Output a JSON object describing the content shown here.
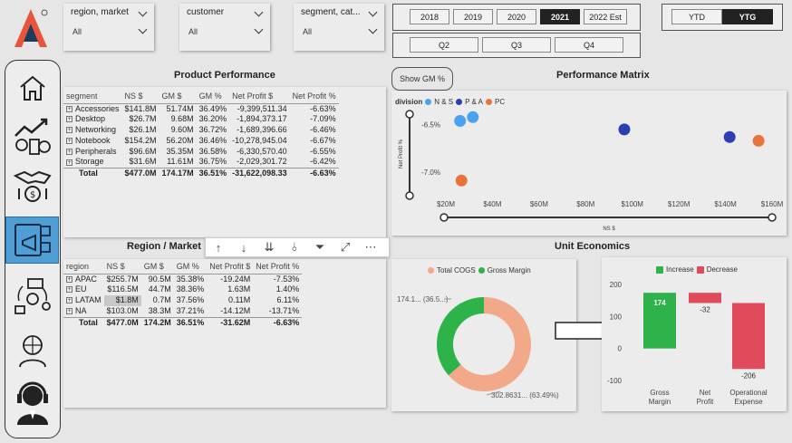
{
  "slicers": {
    "region": {
      "label": "region, market",
      "value": "All"
    },
    "customer": {
      "label": "customer",
      "value": "All"
    },
    "segment": {
      "label": "segment, cat...",
      "value": "All"
    }
  },
  "years": [
    "2018",
    "2019",
    "2020",
    "2021",
    "2022 Est"
  ],
  "selected_year": "2021",
  "quarters": [
    "Q2",
    "Q3",
    "Q4"
  ],
  "period_toggle": {
    "ytd": "YTD",
    "ytg": "YTG"
  },
  "product_performance": {
    "title": "Product Performance",
    "columns": [
      "segment",
      "NS $",
      "GM $",
      "GM %",
      "Net Profit $",
      "Net Profit %"
    ],
    "rows": [
      [
        "Accessories",
        "$141.8M",
        "51.74M",
        "36.49%",
        "-9,399,511.34",
        "-6.63%"
      ],
      [
        "Desktop",
        "$26.7M",
        "9.68M",
        "36.20%",
        "-1,894,373.17",
        "-7.09%"
      ],
      [
        "Networking",
        "$26.1M",
        "9.60M",
        "36.72%",
        "-1,689,396.66",
        "-6.46%"
      ],
      [
        "Notebook",
        "$154.2M",
        "56.20M",
        "36.46%",
        "-10,278,945.04",
        "-6.67%"
      ],
      [
        "Peripherals",
        "$96.6M",
        "35.35M",
        "36.58%",
        "-6,330,570.40",
        "-6.55%"
      ],
      [
        "Storage",
        "$31.6M",
        "11.61M",
        "36.75%",
        "-2,029,301.72",
        "-6.42%"
      ]
    ],
    "total": [
      "Total",
      "$477.0M",
      "174.17M",
      "36.51%",
      "-31,622,098.33",
      "-6.63%"
    ]
  },
  "show_gm_button": "Show GM %",
  "performance_matrix": {
    "title": "Performance Matrix",
    "legend_title": "division",
    "legend": [
      {
        "name": "N & S",
        "color": "#4aa3f0"
      },
      {
        "name": "P & A",
        "color": "#2b3fb0"
      },
      {
        "name": "PC",
        "color": "#e8743b"
      }
    ]
  },
  "region_market": {
    "title": "Region / Market",
    "title_tail": "n",
    "columns": [
      "region",
      "NS $",
      "GM $",
      "GM %",
      "Net Profit $",
      "Net Profit %"
    ],
    "rows": [
      [
        "APAC",
        "$255.7M",
        "90.5M",
        "35.38%",
        "-19.24M",
        "-7.53%"
      ],
      [
        "EU",
        "$116.5M",
        "44.7M",
        "38.36%",
        "1.63M",
        "1.40%"
      ],
      [
        "LATAM",
        "$1.8M",
        "0.7M",
        "37.56%",
        "0.11M",
        "6.11%"
      ],
      [
        "NA",
        "$103.0M",
        "38.3M",
        "37.21%",
        "-14.12M",
        "-13.71%"
      ]
    ],
    "total": [
      "Total",
      "$477.0M",
      "174.2M",
      "36.51%",
      "-31.62M",
      "-6.63%"
    ]
  },
  "toolbar_icons": [
    "arrow-up-icon",
    "arrow-down-icon",
    "double-arrow-down-icon",
    "expand-hierarchy-icon",
    "filter-icon",
    "focus-mode-icon",
    "more-options-icon"
  ],
  "unit_economics": {
    "title": "Unit Economics",
    "donut_legend": [
      {
        "name": "Total COGS",
        "color": "#f2a98a"
      },
      {
        "name": "Gross Margin",
        "color": "#2db34a"
      }
    ],
    "donut_label_top": "174.1... (36.5...)",
    "donut_label_bottom": "302.8631... (63.49%)",
    "waterfall_legend": [
      {
        "name": "Increase",
        "color": "#2db34a"
      },
      {
        "name": "Decrease",
        "color": "#e04a5a"
      }
    ]
  },
  "chart_data": [
    {
      "type": "scatter",
      "title": "Performance Matrix",
      "xlabel": "NS $",
      "ylabel": "Net Profit %",
      "xlim": [
        20,
        160
      ],
      "ylim": [
        -7.25,
        -6.35
      ],
      "x_ticks": [
        "$20M",
        "$40M",
        "$60M",
        "$80M",
        "$100M",
        "$120M",
        "$140M",
        "$160M"
      ],
      "y_ticks": [
        "-6.5%",
        "-7.0%"
      ],
      "series": [
        {
          "name": "N & S",
          "points": [
            {
              "x": 26.1,
              "y": -6.46
            },
            {
              "x": 31.6,
              "y": -6.42
            }
          ]
        },
        {
          "name": "P & A",
          "points": [
            {
              "x": 96.6,
              "y": -6.55
            },
            {
              "x": 141.8,
              "y": -6.63
            }
          ]
        },
        {
          "name": "PC",
          "points": [
            {
              "x": 26.7,
              "y": -7.09
            },
            {
              "x": 154.2,
              "y": -6.67
            }
          ]
        }
      ],
      "legend_position": "top-left"
    },
    {
      "type": "pie",
      "title": "Unit Economics",
      "slices": [
        {
          "name": "Total COGS",
          "value": 302.86,
          "percent": 63.49
        },
        {
          "name": "Gross Margin",
          "value": 174.17,
          "percent": 36.51
        }
      ]
    },
    {
      "type": "bar",
      "subtype": "waterfall",
      "categories": [
        "Gross Margin",
        "Net Profit",
        "Operational Expense"
      ],
      "values": [
        174,
        -32,
        -206
      ],
      "labels": [
        "174",
        "-32",
        "-206"
      ],
      "y_ticks": [
        "200",
        "100",
        "0",
        "-100"
      ],
      "ylim": [
        -120,
        200
      ]
    }
  ]
}
